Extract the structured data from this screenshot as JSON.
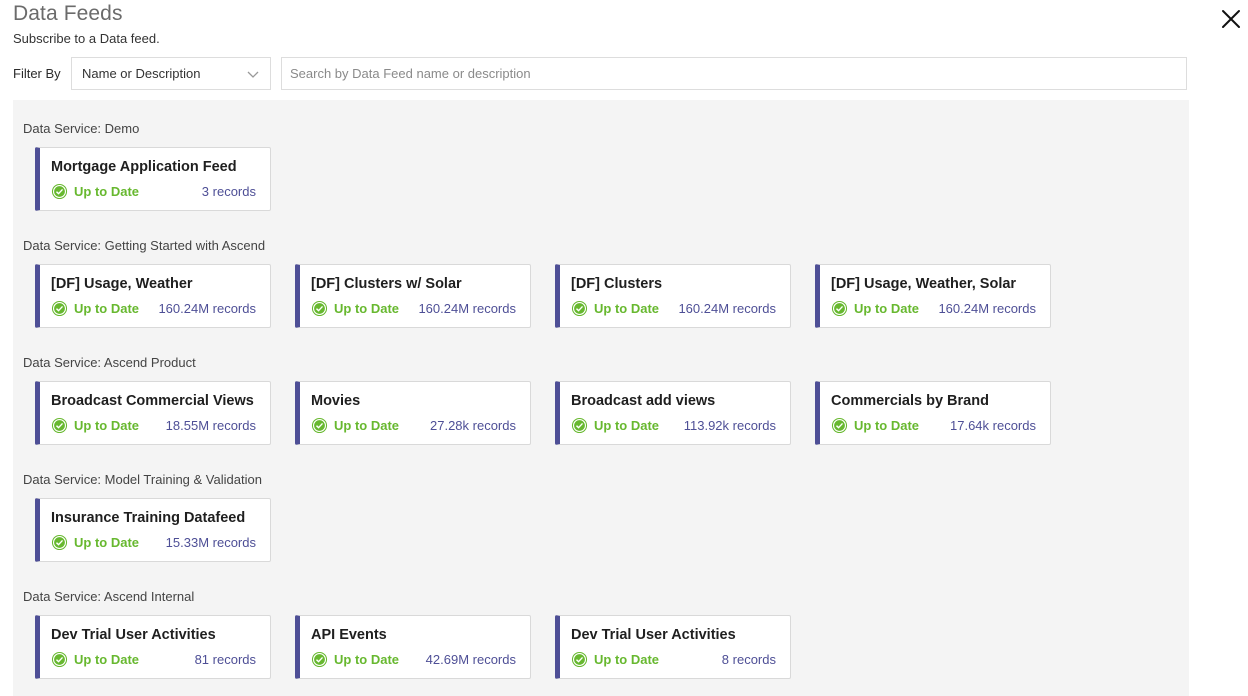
{
  "header": {
    "title": "Data Feeds",
    "subtitle": "Subscribe to a Data feed."
  },
  "filter": {
    "label": "Filter By",
    "selected": "Name or Description",
    "search_placeholder": "Search by Data Feed name or description",
    "search_value": ""
  },
  "colors": {
    "accent": "#4e4f96",
    "status_ok": "#67b82f",
    "panel_bg": "#f4f4f4"
  },
  "groups": [
    {
      "title": "Data Service: Demo",
      "feeds": [
        {
          "name": "Mortgage Application Feed",
          "status": "Up to Date",
          "records": "3 records"
        }
      ]
    },
    {
      "title": "Data Service: Getting Started with Ascend",
      "feeds": [
        {
          "name": "[DF] Usage, Weather",
          "status": "Up to Date",
          "records": "160.24M records"
        },
        {
          "name": "[DF] Clusters w/ Solar",
          "status": "Up to Date",
          "records": "160.24M records"
        },
        {
          "name": "[DF] Clusters",
          "status": "Up to Date",
          "records": "160.24M records"
        },
        {
          "name": "[DF] Usage, Weather, Solar",
          "status": "Up to Date",
          "records": "160.24M records"
        }
      ]
    },
    {
      "title": "Data Service: Ascend Product",
      "feeds": [
        {
          "name": "Broadcast Commercial Views",
          "status": "Up to Date",
          "records": "18.55M records"
        },
        {
          "name": "Movies",
          "status": "Up to Date",
          "records": "27.28k records"
        },
        {
          "name": "Broadcast add views",
          "status": "Up to Date",
          "records": "113.92k records"
        },
        {
          "name": "Commercials by Brand",
          "status": "Up to Date",
          "records": "17.64k records"
        }
      ]
    },
    {
      "title": "Data Service: Model Training & Validation",
      "feeds": [
        {
          "name": "Insurance Training Datafeed",
          "status": "Up to Date",
          "records": "15.33M records"
        }
      ]
    },
    {
      "title": "Data Service: Ascend Internal",
      "feeds": [
        {
          "name": "Dev Trial User Activities",
          "status": "Up to Date",
          "records": "81 records"
        },
        {
          "name": "API Events",
          "status": "Up to Date",
          "records": "42.69M records"
        },
        {
          "name": "Dev Trial User Activities",
          "status": "Up to Date",
          "records": "8 records"
        }
      ]
    }
  ]
}
